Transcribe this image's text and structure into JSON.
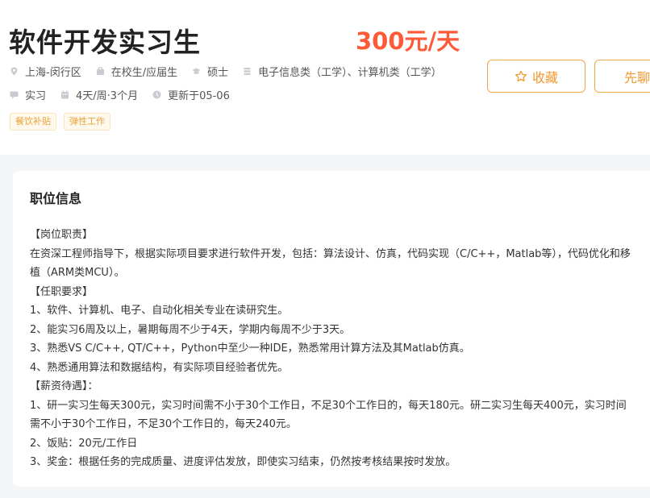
{
  "job": {
    "title": "软件开发实习生",
    "salary": "300元/天"
  },
  "meta_row1": [
    {
      "icon": "location-icon",
      "text": "上海-闵行区"
    },
    {
      "icon": "briefcase-icon",
      "text": "在校生/应届生"
    },
    {
      "icon": "graduation-cap-icon",
      "text": "硕士"
    },
    {
      "icon": "book-icon",
      "text": "电子信息类（工学）、计算机类（工学）"
    }
  ],
  "meta_row2": [
    {
      "icon": "chat-icon",
      "text": "实习"
    },
    {
      "icon": "calendar-icon",
      "text": "4天/周·3个月"
    },
    {
      "icon": "clock-icon",
      "text": "更新于05-06"
    }
  ],
  "tags": [
    "餐饮补贴",
    "弹性工作"
  ],
  "actions": {
    "favorite_label": "收藏",
    "chat_label": "先聊"
  },
  "colors": {
    "accent_orange": "#f09a2e",
    "salary_red": "#ff5a38"
  },
  "section": {
    "title": "职位信息",
    "lines": [
      "【岗位职责】",
      "在资深工程师指导下，根据实际项目要求进行软件开发，包括：算法设计、仿真，代码实现（C/C++，Matlab等），代码优化和移植（ARM类MCU）。",
      "【任职要求】",
      "1、软件、计算机、电子、自动化相关专业在读研究生。",
      "2、能实习6周及以上，暑期每周不少于4天，学期内每周不少于3天。",
      "3、熟悉VS C/C++, QT/C++，Python中至少一种IDE，熟悉常用计算方法及其Matlab仿真。",
      "4、熟悉通用算法和数据结构，有实际项目经验者优先。",
      "【薪资待遇】：",
      "1、研一实习生每天300元，实习时间需不小于30个工作日，不足30个工作日的，每天180元。研二实习生每天400元，实习时间需不小于30个工作日，不足30个工作日的，每天240元。",
      "2、饭贴：20元/工作日",
      "3、奖金：根据任务的完成质量、进度评估发放，即使实习结束，仍然按考核结果按时发放。"
    ]
  }
}
